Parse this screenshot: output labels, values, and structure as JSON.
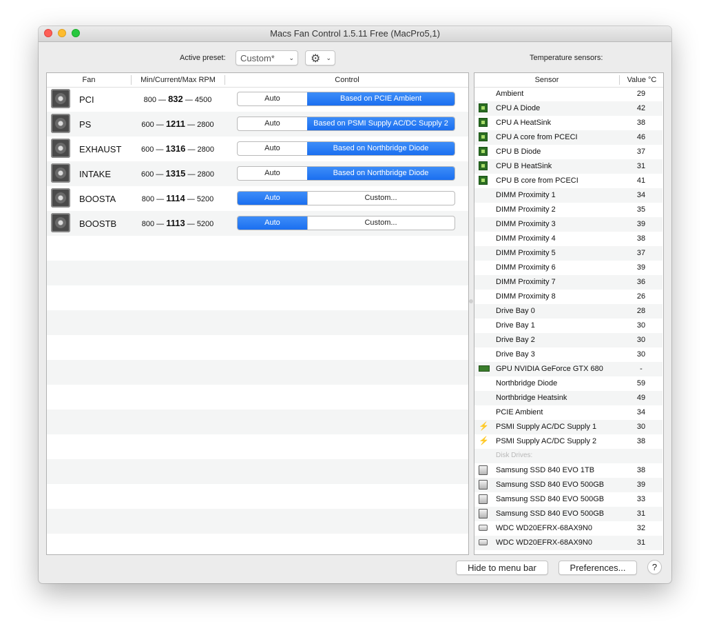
{
  "window": {
    "title": "Macs Fan Control 1.5.11 Free (MacPro5,1)"
  },
  "toolbar": {
    "active_preset_label": "Active preset:",
    "preset_value": "Custom*"
  },
  "sensors_title": "Temperature sensors:",
  "fans_table": {
    "headers": [
      "Fan",
      "Min/Current/Max RPM",
      "Control"
    ],
    "rows": [
      {
        "name": "PCI",
        "min": "800",
        "current": "832",
        "max": "4500",
        "auto_label": "Auto",
        "mode_label": "Based on PCIE Ambient",
        "selected": "mode"
      },
      {
        "name": "PS",
        "min": "600",
        "current": "1211",
        "max": "2800",
        "auto_label": "Auto",
        "mode_label": "Based on PSMI Supply AC/DC Supply 2",
        "selected": "mode"
      },
      {
        "name": "EXHAUST",
        "min": "600",
        "current": "1316",
        "max": "2800",
        "auto_label": "Auto",
        "mode_label": "Based on Northbridge Diode",
        "selected": "mode"
      },
      {
        "name": "INTAKE",
        "min": "600",
        "current": "1315",
        "max": "2800",
        "auto_label": "Auto",
        "mode_label": "Based on Northbridge Diode",
        "selected": "mode"
      },
      {
        "name": "BOOSTA",
        "min": "800",
        "current": "1114",
        "max": "5200",
        "auto_label": "Auto",
        "mode_label": "Custom...",
        "selected": "auto"
      },
      {
        "name": "BOOSTB",
        "min": "800",
        "current": "1113",
        "max": "5200",
        "auto_label": "Auto",
        "mode_label": "Custom...",
        "selected": "auto"
      }
    ]
  },
  "sensors_table": {
    "headers": [
      "Sensor",
      "Value °C"
    ],
    "rows": [
      {
        "name": "Ambient",
        "value": "29",
        "icon": "none"
      },
      {
        "name": "CPU A Diode",
        "value": "42",
        "icon": "cpu-icon"
      },
      {
        "name": "CPU A HeatSink",
        "value": "38",
        "icon": "cpu-icon"
      },
      {
        "name": "CPU A core from PCECI",
        "value": "46",
        "icon": "cpu-icon"
      },
      {
        "name": "CPU B Diode",
        "value": "37",
        "icon": "cpu-icon"
      },
      {
        "name": "CPU B HeatSink",
        "value": "31",
        "icon": "cpu-icon"
      },
      {
        "name": "CPU B core from PCECI",
        "value": "41",
        "icon": "cpu-icon"
      },
      {
        "name": "DIMM Proximity 1",
        "value": "34",
        "icon": "none"
      },
      {
        "name": "DIMM Proximity 2",
        "value": "35",
        "icon": "none"
      },
      {
        "name": "DIMM Proximity 3",
        "value": "39",
        "icon": "none"
      },
      {
        "name": "DIMM Proximity 4",
        "value": "38",
        "icon": "none"
      },
      {
        "name": "DIMM Proximity 5",
        "value": "37",
        "icon": "none"
      },
      {
        "name": "DIMM Proximity 6",
        "value": "39",
        "icon": "none"
      },
      {
        "name": "DIMM Proximity 7",
        "value": "36",
        "icon": "none"
      },
      {
        "name": "DIMM Proximity 8",
        "value": "26",
        "icon": "none"
      },
      {
        "name": "Drive Bay 0",
        "value": "28",
        "icon": "none"
      },
      {
        "name": "Drive Bay 1",
        "value": "30",
        "icon": "none"
      },
      {
        "name": "Drive Bay 2",
        "value": "30",
        "icon": "none"
      },
      {
        "name": "Drive Bay 3",
        "value": "30",
        "icon": "none"
      },
      {
        "name": "GPU NVIDIA GeForce GTX 680",
        "value": "-",
        "icon": "gpu-icon"
      },
      {
        "name": "Northbridge Diode",
        "value": "59",
        "icon": "none"
      },
      {
        "name": "Northbridge Heatsink",
        "value": "49",
        "icon": "none"
      },
      {
        "name": "PCIE Ambient",
        "value": "34",
        "icon": "none"
      },
      {
        "name": "PSMI Supply AC/DC Supply 1",
        "value": "30",
        "icon": "bolt-icon"
      },
      {
        "name": "PSMI Supply AC/DC Supply 2",
        "value": "38",
        "icon": "bolt-icon"
      },
      {
        "name": "Disk Drives:",
        "value": "",
        "icon": "none",
        "header": true
      },
      {
        "name": "Samsung SSD 840 EVO 1TB",
        "value": "38",
        "icon": "ssd-icon"
      },
      {
        "name": "Samsung SSD 840 EVO 500GB",
        "value": "39",
        "icon": "ssd-icon"
      },
      {
        "name": "Samsung SSD 840 EVO 500GB",
        "value": "33",
        "icon": "ssd-icon"
      },
      {
        "name": "Samsung SSD 840 EVO 500GB",
        "value": "31",
        "icon": "ssd-icon"
      },
      {
        "name": "WDC WD20EFRX-68AX9N0",
        "value": "32",
        "icon": "hdd-icon"
      },
      {
        "name": "WDC WD20EFRX-68AX9N0",
        "value": "31",
        "icon": "hdd-icon"
      }
    ]
  },
  "footer": {
    "hide_label": "Hide to menu bar",
    "prefs_label": "Preferences...",
    "help_label": "?"
  },
  "colors": {
    "accent": "#1b6ff0",
    "stripe": "#f4f5f5"
  }
}
